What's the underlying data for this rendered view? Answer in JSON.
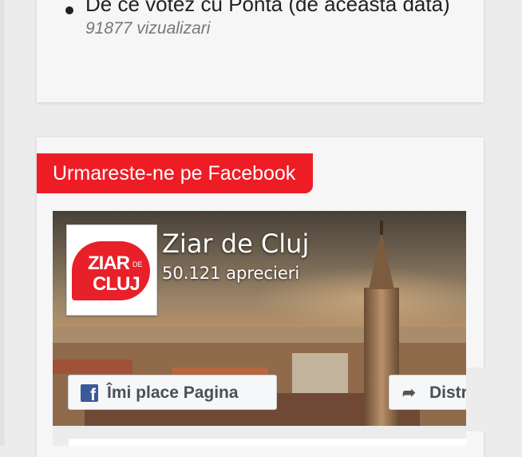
{
  "popular_posts": {
    "items": [
      {
        "title": "De ce votez cu Ponta (de aceasta data)",
        "views": "91877 vizualizari"
      }
    ]
  },
  "facebook_widget": {
    "title": "Urmareste-ne pe Facebook",
    "page_name": "Ziar de Cluj",
    "likes": "50.121 aprecieri",
    "logo_text_1": "ZIAR",
    "logo_text_de": "DE",
    "logo_text_2": "CLUJ",
    "like_button": "Îmi place Pagina",
    "share_button": "Distribuie",
    "brand_color": "#ee1c25",
    "facebook_blue": "#3b5998",
    "icons": [
      "facebook-icon",
      "share-arrow-icon"
    ]
  }
}
